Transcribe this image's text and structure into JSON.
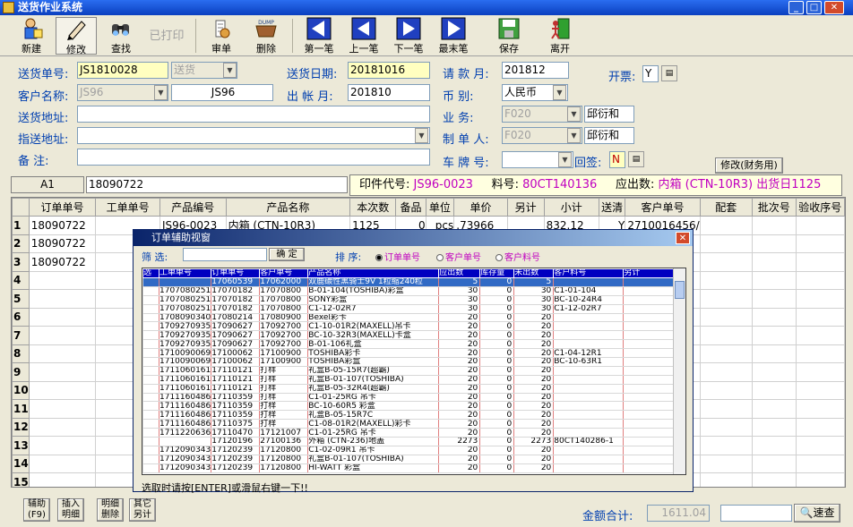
{
  "window": {
    "title": "送货作业系统"
  },
  "toolbar": [
    {
      "label": "新建",
      "icon": "new-icon"
    },
    {
      "label": "修改",
      "icon": "edit-icon"
    },
    {
      "label": "查找",
      "icon": "find-icon"
    },
    {
      "label": "已打印",
      "icon": "printed-icon"
    },
    {
      "label": "审单",
      "icon": "audit-icon"
    },
    {
      "label": "删除",
      "icon": "delete-icon"
    },
    {
      "label": "第一笔",
      "icon": "first-icon"
    },
    {
      "label": "上一笔",
      "icon": "prev-icon"
    },
    {
      "label": "下一笔",
      "icon": "next-icon"
    },
    {
      "label": "最末笔",
      "icon": "last-icon"
    },
    {
      "label": "保存",
      "icon": "save-icon"
    },
    {
      "label": "离开",
      "icon": "exit-icon"
    }
  ],
  "form": {
    "delivery_no_label": "送货单号:",
    "delivery_no": "JS1810028",
    "delivery_type": "送货",
    "delivery_date_label": "送货日期:",
    "delivery_date": "20181016",
    "request_month_label": "请 款 月:",
    "request_month": "201812",
    "invoice_label": "开票:",
    "invoice": "Y",
    "customer_label": "客户名称:",
    "customer_code": "JS96",
    "customer_name": "JS96",
    "account_month_label": "出 帐 月:",
    "account_month": "201810",
    "currency_label": "币     别:",
    "currency": "人民币",
    "address_label": "送货地址:",
    "biz_label": "业     务:",
    "biz_code": "F020",
    "biz_name": "邱衍和",
    "ship_address_label": "指送地址:",
    "maker_label": "制 单 人:",
    "maker_code": "F020",
    "maker_name": "邱衍和",
    "note_label": "备     注:",
    "plate_label": "车 牌 号:",
    "sign_label": "回签:",
    "sign_value": "N",
    "modify_finance": "修改(财务用)"
  },
  "infobar": {
    "print_code_label": "印件代号:",
    "print_code": "JS96-0023",
    "material_label": "料号:",
    "material": "80CT140136",
    "out_label": "应出数:",
    "out_value": "内箱 (CTN-10R3)",
    "overlay": "出货日",
    "overlay_value": "1125"
  },
  "cell": {
    "ref": "A1",
    "value": "18090722"
  },
  "grid": {
    "headers": [
      "订单单号",
      "工单单号",
      "产品编号",
      "产品名称",
      "本次数",
      "备品",
      "单位",
      "单价",
      "另计",
      "小计",
      "送清",
      "客户单号",
      "配套",
      "批次号",
      "验收序号"
    ],
    "rows": [
      [
        "18090722",
        "",
        "JS96-0023",
        "内箱 (CTN-10R3)",
        "1125",
        "0",
        "pcs",
        ".73966",
        "",
        "832.12",
        "Y",
        "2710016456/",
        "",
        "",
        ""
      ],
      [
        "18090722",
        "",
        "",
        "",
        "",
        "",
        "",
        "",
        "",
        "",
        "",
        "",
        "",
        "",
        ""
      ],
      [
        "18090722",
        "",
        "",
        "",
        "",
        "",
        "",
        "",
        "",
        "",
        "",
        "",
        "",
        "",
        ""
      ]
    ]
  },
  "dialog": {
    "title": "订单辅助视窗",
    "filter_label": "筛  选:",
    "confirm": "确 定",
    "sort_label": "排  序:",
    "sort_options": [
      "订单单号",
      "客户单号",
      "客户料号"
    ],
    "headers": [
      "选",
      "工单单号",
      "订单单号",
      "客户单号",
      "产品名称",
      "应出数",
      "库存量",
      "未出数",
      "客户料号",
      "另计"
    ],
    "rows": [
      [
        "",
        "",
        "17060539",
        "17062000",
        "双鹿碳性黑骑士9V 1粒缩240粒",
        "5",
        "0",
        "5",
        "",
        ""
      ],
      [
        "",
        "1707080251",
        "17070182",
        "17070800",
        "B-01-104(TOSHIBA)彩盒",
        "30",
        "0",
        "30",
        "C1-01-104",
        ""
      ],
      [
        "",
        "1707080251",
        "17070182",
        "17070800",
        "SONY彩盒",
        "30",
        "0",
        "30",
        "BC-10-24R4",
        ""
      ],
      [
        "",
        "1707080251",
        "17070182",
        "17070800",
        "C1-12-02R7",
        "30",
        "0",
        "30",
        "C1-12-02R7",
        ""
      ],
      [
        "",
        "1708090340",
        "17080214",
        "17080900",
        "Bexel彩卡",
        "20",
        "0",
        "20",
        "",
        ""
      ],
      [
        "",
        "1709270935",
        "17090627",
        "17092700",
        "C1-10-01R2(MAXELL)吊卡",
        "20",
        "0",
        "20",
        "",
        ""
      ],
      [
        "",
        "1709270935",
        "17090627",
        "17092700",
        "BC-10-32R3(MAXELL)卡盒",
        "20",
        "0",
        "20",
        "",
        ""
      ],
      [
        "",
        "1709270935",
        "17090627",
        "17092700",
        "B-01-106礼盒",
        "20",
        "0",
        "20",
        "",
        ""
      ],
      [
        "",
        "1710090069",
        "17100062",
        "17100900",
        "TOSHIBA彩卡",
        "20",
        "0",
        "20",
        "C1-04-12R1",
        ""
      ],
      [
        "",
        "1710090069",
        "17100062",
        "17100900",
        "TOSHIBA彩盒",
        "20",
        "0",
        "20",
        "BC-10-63R1",
        ""
      ],
      [
        "",
        "1711060161",
        "17110121",
        "打样",
        "礼盒B-05-15R7(超霸)",
        "20",
        "0",
        "20",
        "",
        ""
      ],
      [
        "",
        "1711060161",
        "17110121",
        "打样",
        "礼盒B-01-107(TOSHIBA)",
        "20",
        "0",
        "20",
        "",
        ""
      ],
      [
        "",
        "1711060161",
        "17110121",
        "打样",
        "礼盒B-05-32R4(超霸)",
        "20",
        "0",
        "20",
        "",
        ""
      ],
      [
        "",
        "1711160486",
        "17110359",
        "打样",
        "C1-01-25RG 吊卡",
        "20",
        "0",
        "20",
        "",
        ""
      ],
      [
        "",
        "1711160486",
        "17110359",
        "打样",
        "BC-10-60R5 彩盒",
        "20",
        "0",
        "20",
        "",
        ""
      ],
      [
        "",
        "1711160486",
        "17110359",
        "打样",
        "礼盒B-05-15R7C",
        "20",
        "0",
        "20",
        "",
        ""
      ],
      [
        "",
        "1711160486",
        "17110375",
        "打样",
        "C1-08-01R2(MAXELL)彩卡",
        "20",
        "0",
        "20",
        "",
        ""
      ],
      [
        "",
        "1711220636",
        "17110470",
        "17121007",
        "C1-01-25RG 吊卡",
        "20",
        "0",
        "20",
        "",
        ""
      ],
      [
        "",
        "",
        "17120196",
        "27100136",
        "外箱 (CTN-236)地盖",
        "2273",
        "0",
        "2273",
        "80CT140286-1",
        ""
      ],
      [
        "",
        "1712090343",
        "17120239",
        "17120800",
        "C1-02-09R1 吊卡",
        "20",
        "0",
        "20",
        "",
        ""
      ],
      [
        "",
        "1712090343",
        "17120239",
        "17120800",
        "礼盒B-01-107(TOSHIBA)",
        "20",
        "0",
        "20",
        "",
        ""
      ],
      [
        "",
        "1712090343",
        "17120239",
        "17120800",
        "HI-WATT 彩盒",
        "20",
        "0",
        "20",
        "",
        ""
      ]
    ],
    "status": "选取时请按[ENTER]或滑鼠右键一下!!"
  },
  "bottom": {
    "buttons": [
      "辅助(F9)",
      "插入明细",
      "明细删除",
      "其它另计"
    ],
    "total_label": "金额合计:",
    "total": "1611.04",
    "quick_search": "速查"
  },
  "colors": {
    "title_blue": "#0a3fbf",
    "label_blue": "#003fb0",
    "highlight": "#316ac5",
    "magenta": "#c000c0"
  }
}
